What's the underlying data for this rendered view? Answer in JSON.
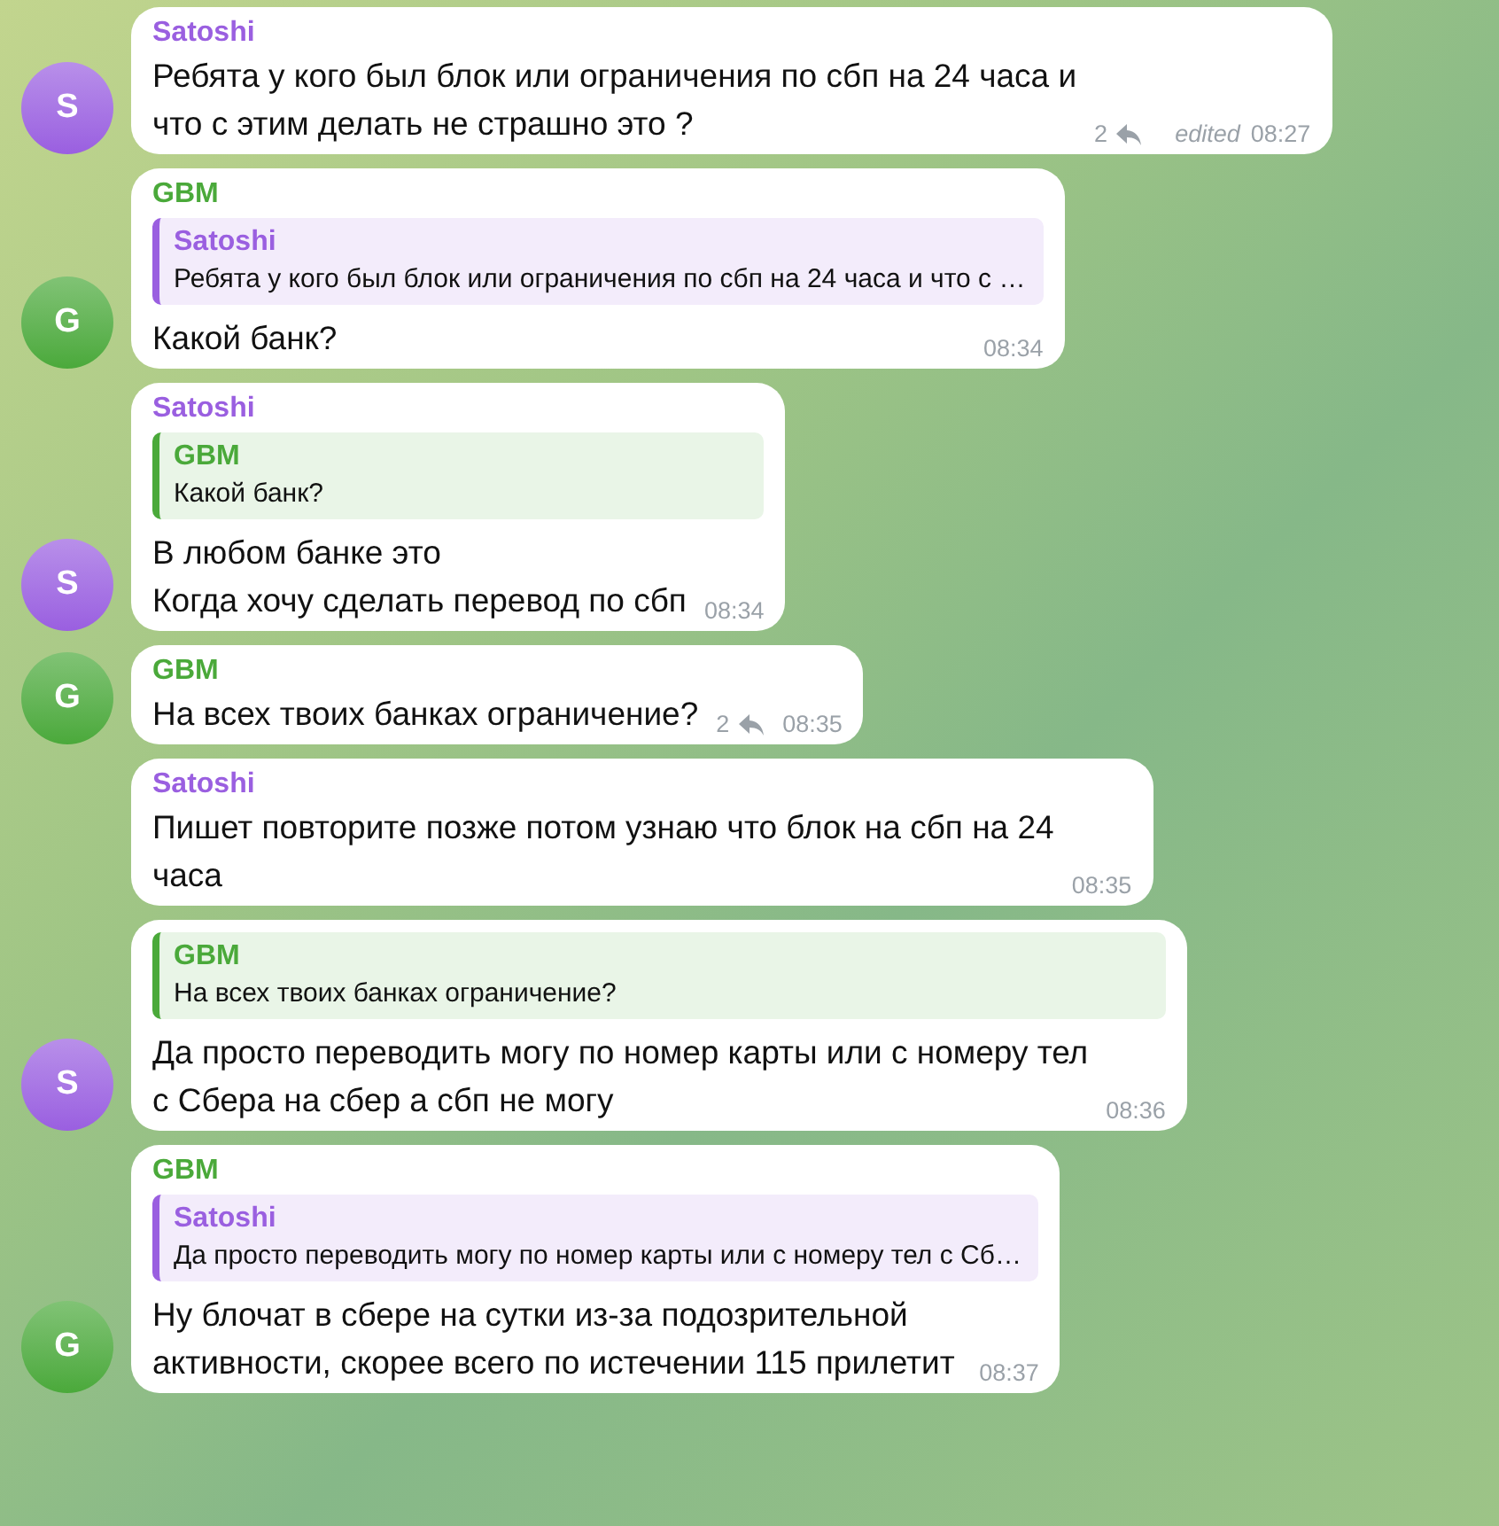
{
  "messages": [
    {
      "sender": "Satoshi",
      "color": "#9a5fe0",
      "avatar": "S",
      "text": "Ребята у кого был блок или ограничения по сбп на 24 часа и\nчто с этим делать не страшно это ?",
      "replies": "2",
      "edited": "edited",
      "time": "08:27"
    },
    {
      "sender": "GBM",
      "color": "#4aa93a",
      "avatar": "G",
      "reply": {
        "name": "Satoshi",
        "color": "#9a5fe0",
        "text": "Ребята у кого был блок или ограничения по сбп на 24 часа и что с …"
      },
      "text": "Какой банк?",
      "time": "08:34"
    },
    {
      "sender": "Satoshi",
      "color": "#9a5fe0",
      "avatar": "S",
      "reply": {
        "name": "GBM",
        "color": "#4aa93a",
        "text": "Какой банк?"
      },
      "text": "В любом банке это\nКогда хочу сделать перевод по сбп",
      "time": "08:34"
    },
    {
      "sender": "GBM",
      "color": "#4aa93a",
      "avatar": "G",
      "text": "На всех твоих банках ограничение?",
      "replies": "2",
      "time": "08:35"
    },
    {
      "sender": "Satoshi",
      "color": "#9a5fe0",
      "text": "Пишет повторите позже потом узнаю что блок на сбп на 24\nчаса",
      "time": "08:35"
    },
    {
      "color": "#9a5fe0",
      "avatar": "S",
      "reply": {
        "name": "GBM",
        "color": "#4aa93a",
        "text": "На всех твоих банках ограничение?"
      },
      "text": "Да просто переводить могу по номер карты или с номеру тел\nс Сбера на сбер а сбп не могу",
      "time": "08:36"
    },
    {
      "sender": "GBM",
      "color": "#4aa93a",
      "avatar": "G",
      "reply": {
        "name": "Satoshi",
        "color": "#9a5fe0",
        "text": "Да просто переводить могу по номер карты или с номеру тел с Сб…"
      },
      "text": "Ну блочат в сбере на сутки из-за подозрительной\nактивности, скорее всего по истечении 115 прилетит",
      "time": "08:37"
    }
  ]
}
